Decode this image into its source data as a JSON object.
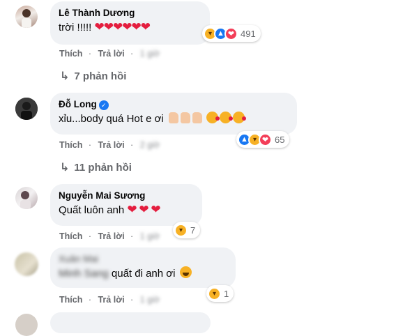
{
  "comments": [
    {
      "author": "Lê Thành Dương",
      "text": "trời !!!!!",
      "hearts": "❤❤❤❤❤❤",
      "reaction_count": "491",
      "like_label": "Thích",
      "reply_label": "Trả lời",
      "time": "1 giờ",
      "replies": "7 phản hồi"
    },
    {
      "author": "Đỗ Long",
      "verified_mark": "✓",
      "text": "xỉu...body quá Hot e ơi",
      "reaction_count": "65",
      "like_label": "Thích",
      "reply_label": "Trả lời",
      "time": "2 giờ",
      "replies": "11 phản hồi"
    },
    {
      "author": "Nguyễn Mai Sương",
      "text": "Quất luôn anh",
      "hearts": "❤ ❤ ❤",
      "reaction_count": "7",
      "like_label": "Thích",
      "reply_label": "Trả lời",
      "time": "1 giờ"
    },
    {
      "author": "Xuân Mai",
      "text_hidden": "Minh Sang",
      "text": "quất đi anh ơi",
      "reaction_count": "1",
      "like_label": "Thích",
      "reply_label": "Trả lời",
      "time": "1 giờ"
    }
  ],
  "icons": {
    "reply_arrow": "↳",
    "haha": "😆",
    "like": "👍",
    "love": "❤"
  },
  "colors": {
    "bubble": "#f0f2f5",
    "like_blue": "#1877f2",
    "love_red": "#f33e58",
    "haha_yellow": "#f7b125",
    "meta_gray": "#65676b"
  }
}
